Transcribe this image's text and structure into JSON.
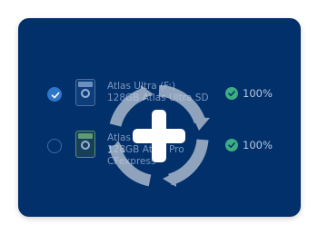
{
  "devices": [
    {
      "selected": true,
      "name_line1": "Atlas Ultra (F:)",
      "name_line2": "128GB Atlas Ultra SD",
      "name_line3": "",
      "progress": "100%"
    },
    {
      "selected": false,
      "name_line1": "Atlas Pro (",
      "name_line2": "128GB Atlas Pro",
      "name_line3": "CFexpress",
      "progress": "100%"
    }
  ],
  "overlay": {
    "icon": "refresh-add-icon"
  },
  "colors": {
    "card_background": "#02306a",
    "accent": "#2f76c8",
    "success": "#3cae82"
  }
}
